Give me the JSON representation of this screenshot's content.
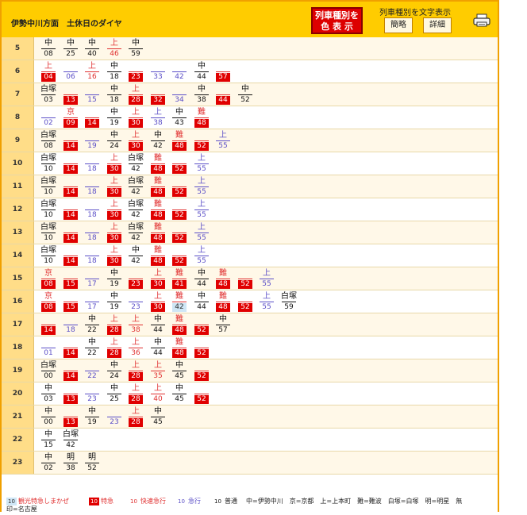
{
  "header": {
    "title": "伊勢中川方面　土休日のダイヤ",
    "color_button": [
      "列車種別を",
      "色 表 示"
    ],
    "text_label": "列車種別を文字表示",
    "simple_button": "簡略",
    "detail_button": "詳細",
    "print_icon": "printer-icon"
  },
  "colors": {
    "local": "#111111",
    "express": "#5b4fc7",
    "rapid_express": "#e03030",
    "limited_express": "#e00000",
    "sightseeing": "#cfe6f5",
    "header_bg": "#ffcc00"
  },
  "legend": {
    "sightseeing_num": "10",
    "sightseeing": "観光特急しまかぜ",
    "limited_num": "10",
    "limited": "特急",
    "rapid_num": "10",
    "rapid": "快速急行",
    "express_num": "10",
    "express": "急行",
    "local_num": "10",
    "local": "普通",
    "abbreviations": "中=伊勢中川　京=京都　上=上本町　難=難波　白塚=白塚　明=明星　無",
    "abbreviations_tail": "印=名古屋"
  },
  "timetable": [
    {
      "hour": "5",
      "trains": [
        {
          "dest": "中",
          "min": "08",
          "type": "local"
        },
        {
          "dest": "中",
          "min": "25",
          "type": "local"
        },
        {
          "dest": "中",
          "min": "40",
          "type": "local"
        },
        {
          "dest": "上",
          "min": "46",
          "type": "rapid"
        },
        {
          "dest": "中",
          "min": "59",
          "type": "local"
        }
      ]
    },
    {
      "hour": "6",
      "trains": [
        {
          "dest": "上",
          "min": "04",
          "type": "ltd"
        },
        {
          "dest": "",
          "min": "06",
          "type": "express"
        },
        {
          "dest": "上",
          "min": "16",
          "type": "rapid"
        },
        {
          "dest": "中",
          "min": "18",
          "type": "local"
        },
        {
          "dest": "",
          "min": "23",
          "type": "ltd"
        },
        {
          "dest": "",
          "min": "33",
          "type": "express"
        },
        {
          "dest": "",
          "min": "42",
          "type": "express"
        },
        {
          "dest": "中",
          "min": "44",
          "type": "local"
        },
        {
          "dest": "",
          "min": "57",
          "type": "ltd"
        }
      ]
    },
    {
      "hour": "7",
      "trains": [
        {
          "dest": "白塚",
          "min": "03",
          "type": "local"
        },
        {
          "dest": "",
          "min": "13",
          "type": "ltd"
        },
        {
          "dest": "",
          "min": "15",
          "type": "express"
        },
        {
          "dest": "中",
          "min": "18",
          "type": "local"
        },
        {
          "dest": "上",
          "min": "28",
          "type": "ltd"
        },
        {
          "dest": "",
          "min": "32",
          "type": "ltd"
        },
        {
          "dest": "",
          "min": "34",
          "type": "express"
        },
        {
          "dest": "中",
          "min": "38",
          "type": "local"
        },
        {
          "dest": "",
          "min": "44",
          "type": "ltd"
        },
        {
          "dest": "中",
          "min": "52",
          "type": "local"
        }
      ]
    },
    {
      "hour": "8",
      "trains": [
        {
          "dest": "",
          "min": "02",
          "type": "express"
        },
        {
          "dest": "京",
          "min": "09",
          "type": "ltd"
        },
        {
          "dest": "",
          "min": "14",
          "type": "ltd"
        },
        {
          "dest": "中",
          "min": "19",
          "type": "local"
        },
        {
          "dest": "上",
          "min": "30",
          "type": "ltd"
        },
        {
          "dest": "上",
          "min": "38",
          "type": "express"
        },
        {
          "dest": "中",
          "min": "43",
          "type": "local"
        },
        {
          "dest": "難",
          "min": "48",
          "type": "ltd"
        }
      ]
    },
    {
      "hour": "9",
      "trains": [
        {
          "dest": "白塚",
          "min": "08",
          "type": "local"
        },
        {
          "dest": "",
          "min": "14",
          "type": "ltd"
        },
        {
          "dest": "",
          "min": "19",
          "type": "express"
        },
        {
          "dest": "中",
          "min": "24",
          "type": "local"
        },
        {
          "dest": "上",
          "min": "30",
          "type": "ltd"
        },
        {
          "dest": "中",
          "min": "42",
          "type": "local"
        },
        {
          "dest": "難",
          "min": "48",
          "type": "ltd"
        },
        {
          "dest": "",
          "min": "52",
          "type": "ltd"
        },
        {
          "dest": "上",
          "min": "55",
          "type": "express"
        }
      ]
    },
    {
      "hour": "10",
      "trains": [
        {
          "dest": "白塚",
          "min": "10",
          "type": "local"
        },
        {
          "dest": "",
          "min": "14",
          "type": "ltd"
        },
        {
          "dest": "",
          "min": "18",
          "type": "express"
        },
        {
          "dest": "上",
          "min": "30",
          "type": "ltd"
        },
        {
          "dest": "白塚",
          "min": "42",
          "type": "local"
        },
        {
          "dest": "難",
          "min": "48",
          "type": "ltd"
        },
        {
          "dest": "",
          "min": "52",
          "type": "ltd"
        },
        {
          "dest": "上",
          "min": "55",
          "type": "express"
        }
      ]
    },
    {
      "hour": "11",
      "trains": [
        {
          "dest": "白塚",
          "min": "10",
          "type": "local"
        },
        {
          "dest": "",
          "min": "14",
          "type": "ltd"
        },
        {
          "dest": "",
          "min": "18",
          "type": "express"
        },
        {
          "dest": "上",
          "min": "30",
          "type": "ltd"
        },
        {
          "dest": "白塚",
          "min": "42",
          "type": "local"
        },
        {
          "dest": "難",
          "min": "48",
          "type": "ltd"
        },
        {
          "dest": "",
          "min": "52",
          "type": "ltd"
        },
        {
          "dest": "上",
          "min": "55",
          "type": "express"
        }
      ]
    },
    {
      "hour": "12",
      "trains": [
        {
          "dest": "白塚",
          "min": "10",
          "type": "local"
        },
        {
          "dest": "",
          "min": "14",
          "type": "ltd"
        },
        {
          "dest": "",
          "min": "18",
          "type": "express"
        },
        {
          "dest": "上",
          "min": "30",
          "type": "ltd"
        },
        {
          "dest": "白塚",
          "min": "42",
          "type": "local"
        },
        {
          "dest": "難",
          "min": "48",
          "type": "ltd"
        },
        {
          "dest": "",
          "min": "52",
          "type": "ltd"
        },
        {
          "dest": "上",
          "min": "55",
          "type": "express"
        }
      ]
    },
    {
      "hour": "13",
      "trains": [
        {
          "dest": "白塚",
          "min": "10",
          "type": "local"
        },
        {
          "dest": "",
          "min": "14",
          "type": "ltd"
        },
        {
          "dest": "",
          "min": "18",
          "type": "express"
        },
        {
          "dest": "上",
          "min": "30",
          "type": "ltd"
        },
        {
          "dest": "白塚",
          "min": "42",
          "type": "local"
        },
        {
          "dest": "難",
          "min": "48",
          "type": "ltd"
        },
        {
          "dest": "",
          "min": "52",
          "type": "ltd"
        },
        {
          "dest": "上",
          "min": "55",
          "type": "express"
        }
      ]
    },
    {
      "hour": "14",
      "trains": [
        {
          "dest": "白塚",
          "min": "10",
          "type": "local"
        },
        {
          "dest": "",
          "min": "14",
          "type": "ltd"
        },
        {
          "dest": "",
          "min": "18",
          "type": "express"
        },
        {
          "dest": "上",
          "min": "30",
          "type": "ltd"
        },
        {
          "dest": "中",
          "min": "42",
          "type": "local"
        },
        {
          "dest": "難",
          "min": "48",
          "type": "ltd"
        },
        {
          "dest": "",
          "min": "52",
          "type": "ltd"
        },
        {
          "dest": "上",
          "min": "55",
          "type": "express"
        }
      ]
    },
    {
      "hour": "15",
      "trains": [
        {
          "dest": "京",
          "min": "08",
          "type": "ltd"
        },
        {
          "dest": "",
          "min": "15",
          "type": "ltd"
        },
        {
          "dest": "",
          "min": "17",
          "type": "express"
        },
        {
          "dest": "中",
          "min": "19",
          "type": "local"
        },
        {
          "dest": "",
          "min": "23",
          "type": "ltd"
        },
        {
          "dest": "上",
          "min": "30",
          "type": "ltd"
        },
        {
          "dest": "難",
          "min": "41",
          "type": "ltd"
        },
        {
          "dest": "中",
          "min": "44",
          "type": "local"
        },
        {
          "dest": "難",
          "min": "48",
          "type": "ltd"
        },
        {
          "dest": "",
          "min": "52",
          "type": "ltd"
        },
        {
          "dest": "上",
          "min": "55",
          "type": "express"
        }
      ]
    },
    {
      "hour": "16",
      "trains": [
        {
          "dest": "京",
          "min": "08",
          "type": "ltd"
        },
        {
          "dest": "",
          "min": "15",
          "type": "ltd"
        },
        {
          "dest": "",
          "min": "17",
          "type": "express"
        },
        {
          "dest": "中",
          "min": "19",
          "type": "local"
        },
        {
          "dest": "",
          "min": "23",
          "type": "express"
        },
        {
          "dest": "上",
          "min": "30",
          "type": "ltd"
        },
        {
          "dest": "難",
          "min": "42",
          "type": "sight"
        },
        {
          "dest": "中",
          "min": "44",
          "type": "local"
        },
        {
          "dest": "難",
          "min": "48",
          "type": "ltd"
        },
        {
          "dest": "",
          "min": "52",
          "type": "ltd"
        },
        {
          "dest": "上",
          "min": "55",
          "type": "express"
        },
        {
          "dest": "白塚",
          "min": "59",
          "type": "local"
        }
      ]
    },
    {
      "hour": "17",
      "trains": [
        {
          "dest": "",
          "min": "14",
          "type": "ltd"
        },
        {
          "dest": "",
          "min": "18",
          "type": "express"
        },
        {
          "dest": "中",
          "min": "22",
          "type": "local"
        },
        {
          "dest": "上",
          "min": "28",
          "type": "ltd"
        },
        {
          "dest": "上",
          "min": "38",
          "type": "rapid"
        },
        {
          "dest": "中",
          "min": "44",
          "type": "local"
        },
        {
          "dest": "難",
          "min": "48",
          "type": "ltd"
        },
        {
          "dest": "",
          "min": "52",
          "type": "ltd"
        },
        {
          "dest": "中",
          "min": "57",
          "type": "local"
        }
      ]
    },
    {
      "hour": "18",
      "trains": [
        {
          "dest": "",
          "min": "01",
          "type": "express"
        },
        {
          "dest": "",
          "min": "14",
          "type": "ltd"
        },
        {
          "dest": "中",
          "min": "22",
          "type": "local"
        },
        {
          "dest": "上",
          "min": "28",
          "type": "ltd"
        },
        {
          "dest": "上",
          "min": "36",
          "type": "rapid"
        },
        {
          "dest": "中",
          "min": "44",
          "type": "local"
        },
        {
          "dest": "難",
          "min": "48",
          "type": "ltd"
        },
        {
          "dest": "",
          "min": "52",
          "type": "ltd"
        }
      ]
    },
    {
      "hour": "19",
      "trains": [
        {
          "dest": "白塚",
          "min": "00",
          "type": "local"
        },
        {
          "dest": "",
          "min": "14",
          "type": "ltd"
        },
        {
          "dest": "",
          "min": "22",
          "type": "express"
        },
        {
          "dest": "中",
          "min": "24",
          "type": "local"
        },
        {
          "dest": "上",
          "min": "28",
          "type": "ltd"
        },
        {
          "dest": "上",
          "min": "35",
          "type": "rapid"
        },
        {
          "dest": "中",
          "min": "45",
          "type": "local"
        },
        {
          "dest": "",
          "min": "52",
          "type": "ltd"
        }
      ]
    },
    {
      "hour": "20",
      "trains": [
        {
          "dest": "中",
          "min": "03",
          "type": "local"
        },
        {
          "dest": "",
          "min": "13",
          "type": "ltd"
        },
        {
          "dest": "",
          "min": "23",
          "type": "express"
        },
        {
          "dest": "中",
          "min": "25",
          "type": "local"
        },
        {
          "dest": "上",
          "min": "28",
          "type": "ltd"
        },
        {
          "dest": "上",
          "min": "40",
          "type": "rapid"
        },
        {
          "dest": "中",
          "min": "45",
          "type": "local"
        },
        {
          "dest": "",
          "min": "52",
          "type": "ltd"
        }
      ]
    },
    {
      "hour": "21",
      "trains": [
        {
          "dest": "中",
          "min": "00",
          "type": "local"
        },
        {
          "dest": "",
          "min": "13",
          "type": "ltd"
        },
        {
          "dest": "中",
          "min": "19",
          "type": "local"
        },
        {
          "dest": "",
          "min": "23",
          "type": "express"
        },
        {
          "dest": "上",
          "min": "28",
          "type": "ltd"
        },
        {
          "dest": "中",
          "min": "45",
          "type": "local"
        }
      ]
    },
    {
      "hour": "22",
      "trains": [
        {
          "dest": "中",
          "min": "15",
          "type": "local"
        },
        {
          "dest": "白塚",
          "min": "42",
          "type": "local"
        }
      ]
    },
    {
      "hour": "23",
      "trains": [
        {
          "dest": "中",
          "min": "02",
          "type": "local"
        },
        {
          "dest": "明",
          "min": "38",
          "type": "local"
        },
        {
          "dest": "明",
          "min": "52",
          "type": "local"
        }
      ]
    }
  ]
}
